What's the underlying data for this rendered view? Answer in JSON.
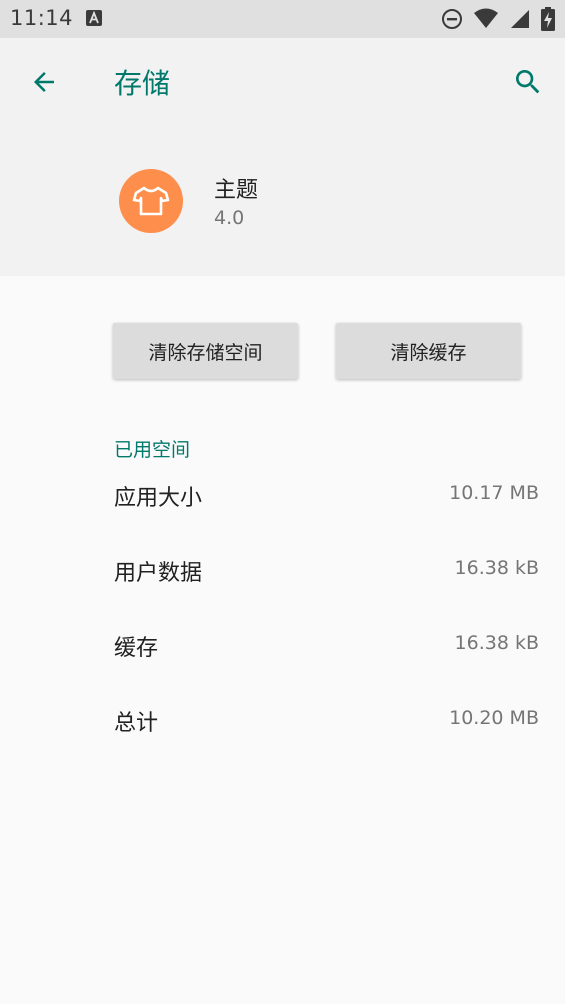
{
  "status_bar": {
    "time": "11:14",
    "icons": [
      "notification-a-icon",
      "dnd-icon",
      "wifi-icon",
      "signal-icon",
      "battery-charging-icon"
    ]
  },
  "app_bar": {
    "title": "存储",
    "back_icon": "arrow-back-icon",
    "search_icon": "search-icon"
  },
  "app_info": {
    "name": "主题",
    "version": "4.0",
    "icon": "tshirt-icon",
    "icon_color": "#fe8e4b"
  },
  "actions": {
    "clear_storage": "清除存储空间",
    "clear_cache": "清除缓存"
  },
  "storage": {
    "section_title": "已用空间",
    "rows": [
      {
        "label": "应用大小",
        "value": "10.17 MB"
      },
      {
        "label": "用户数据",
        "value": "16.38 kB"
      },
      {
        "label": "缓存",
        "value": "16.38 kB"
      },
      {
        "label": "总计",
        "value": "10.20 MB"
      }
    ]
  },
  "colors": {
    "accent": "#00796b",
    "app_bar_bg": "#f2f2f2",
    "status_bar_bg": "#e0e0e0",
    "page_bg": "#fafafa",
    "button_bg": "#dcdcdc"
  }
}
